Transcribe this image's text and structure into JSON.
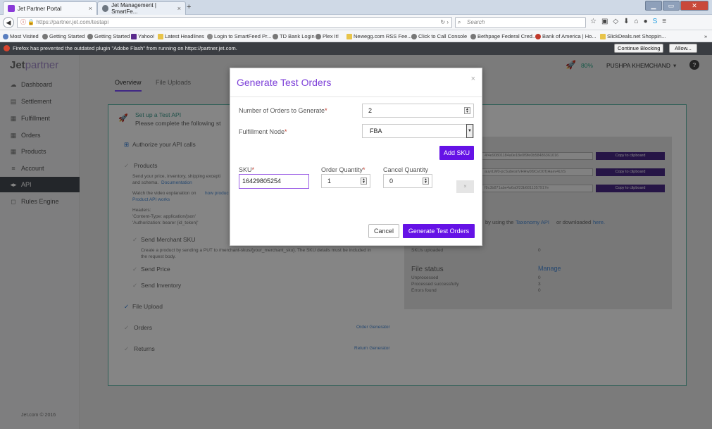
{
  "browser": {
    "tabs": [
      {
        "label": "Jet Partner Portal",
        "close": "×"
      },
      {
        "label": "Jet Management | SmartFe...",
        "close": "×"
      }
    ],
    "new_tab": "+",
    "url_domain": "https://partner.jet.com",
    "url_path": "/testapi",
    "search_placeholder": "Search",
    "bookmarks": [
      "Most Visited",
      "Getting Started",
      "Getting Started",
      "Yahoo!",
      "Latest Headlines",
      "Login to SmartFeed Pr...",
      "TD Bank Login",
      "Plex It!",
      "Newegg.com RSS Fee...",
      "Click to Call Console",
      "Bethpage Federal Cred...",
      "Bank of America | Ho...",
      "SlickDeals.net Shoppin..."
    ],
    "flash_message": "Firefox has prevented the outdated plugin \"Adobe Flash\" from running on https://partner.jet.com.",
    "continue_blocking": "Continue Blocking",
    "allow": "Allow..."
  },
  "app": {
    "logo_jet": "Jet",
    "logo_partner": "partner",
    "progress": "80%",
    "user": "PUSHPA KHEMCHAND",
    "user_caret": "▾",
    "help": "?",
    "sidebar": [
      {
        "label": "Dashboard",
        "icon": "☁"
      },
      {
        "label": "Settlement",
        "icon": "▤"
      },
      {
        "label": "Fulfillment",
        "icon": "▦"
      },
      {
        "label": "Orders",
        "icon": "▦"
      },
      {
        "label": "Products",
        "icon": "▦"
      },
      {
        "label": "Account",
        "icon": "≡"
      },
      {
        "label": "API",
        "icon": "◂▸"
      },
      {
        "label": "Rules Engine",
        "icon": "◻"
      }
    ],
    "copyright": "Jet.com © 2016",
    "page_tabs": [
      "Overview",
      "File Uploads"
    ],
    "setup_title": "Set up a Test API",
    "setup_subtitle": "Please complete the following st",
    "steps": {
      "authorize": "Authorize your API calls",
      "products": "Products",
      "products_desc_1": "Send your price, inventory, shipping excepti",
      "products_desc_2": "and schema.",
      "documentation": "Documentation",
      "video_1": "Watch the video explanation on",
      "video_link": "how produc",
      "video_2": "Product API works",
      "headers": "Headers:",
      "header_ct": "'Content-Type: application/json'",
      "header_auth": "'Authorization: bearer {id_token}'",
      "send_sku": "Send Merchant SKU",
      "sku_desc_1": "Create a product by sending a PUT to /merchant-skus/{your_merchant_sku}. The SKU details must be included in",
      "sku_desc_2": "the request body.",
      "send_price": "Send Price",
      "send_inventory": "Send Inventory",
      "file_upload": "File Upload",
      "orders": "Orders",
      "order_generator": "Order Generator",
      "returns": "Returns",
      "return_generator": "Return Generator"
    },
    "keys": [
      "4f4e90801184a0e18e0f9fe0b58486361016",
      "auyrLW0-pcSubesnVHHw0l9CvO0TjHaev4LhS",
      "f8c3b871abe4a6a0f23b6811357917e"
    ],
    "copy_label": "Copy to clipboard",
    "taxonomy_text": "by using the",
    "taxonomy_link": "Taxonomy API",
    "taxonomy_tail": "or downloaded",
    "taxonomy_here": "here.",
    "skus_uploaded_label": "SKUs uploaded",
    "skus_uploaded_value": "0",
    "file_status": "File status",
    "manage": "Manage",
    "status_rows": [
      {
        "label": "Unprocessed",
        "value": "0"
      },
      {
        "label": "Processed successfully",
        "value": "3"
      },
      {
        "label": "Errors found",
        "value": "0"
      }
    ]
  },
  "modal": {
    "title": "Generate Test Orders",
    "close": "×",
    "num_orders_label": "Number of Orders to Generate",
    "num_orders_value": "2",
    "node_label": "Fulfillment Node",
    "node_value": "FBA",
    "add_sku": "Add SKU",
    "sku_label": "SKU",
    "sku_value": "16429805254",
    "order_qty_label": "Order Quantity",
    "order_qty_value": "1",
    "cancel_qty_label": "Cancel Quantity",
    "cancel_qty_value": "0",
    "remove": "×",
    "req": "*",
    "cancel": "Cancel",
    "submit": "Generate Test Orders"
  },
  "colors": {
    "accent": "#6512e6",
    "title_purple": "#7c3fd8",
    "teal": "#5fb8aa",
    "rocket_green": "#2aa889"
  }
}
